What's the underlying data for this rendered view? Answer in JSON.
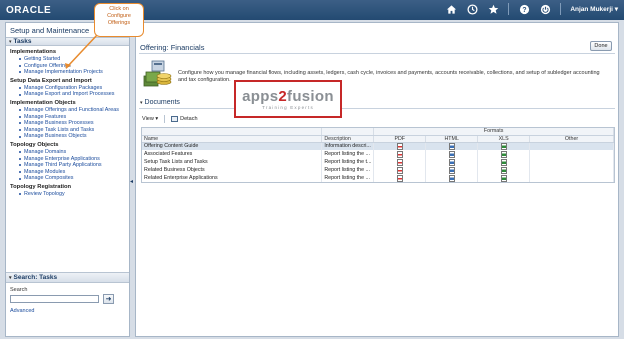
{
  "header": {
    "logo": "ORACLE",
    "user": "Anjan Mukerji ▾",
    "icons": [
      "home-icon",
      "clock-icon",
      "star-icon",
      "help-icon",
      "power-icon"
    ]
  },
  "left_panel": {
    "title": "Setup and Maintenance",
    "tasks_header": "Tasks",
    "groups": [
      {
        "title": "Implementations",
        "items": [
          "Getting Started",
          "Configure Offerings",
          "Manage Implementation Projects"
        ]
      },
      {
        "title": "Setup Data Export and Import",
        "items": [
          "Manage Configuration Packages",
          "Manage Export and Import Processes"
        ]
      },
      {
        "title": "Implementation Objects",
        "items": [
          "Manage Offerings and Functional Areas",
          "Manage Features",
          "Manage Business Processes",
          "Manage Task Lists and Tasks",
          "Manage Business Objects"
        ]
      },
      {
        "title": "Topology Objects",
        "items": [
          "Manage Domains",
          "Manage Enterprise Applications",
          "Manage Third Party Applications",
          "Manage Modules",
          "Manage Composites"
        ]
      },
      {
        "title": "Topology Registration",
        "items": [
          "Review Topology"
        ]
      }
    ],
    "search": {
      "header": "Search: Tasks",
      "label": "Search",
      "value": "",
      "advanced": "Advanced"
    }
  },
  "callout": {
    "lines": [
      "Click on",
      "Configure",
      "Offerings"
    ]
  },
  "main": {
    "title": "Offering: Financials",
    "done_button": "Done",
    "description": "Configure how you manage financial flows, including assets, ledgers, cash cycle, invoices and payments, accounts receivable, collections, and setup of subledger accounting and tax configuration.",
    "documents_header": "Documents",
    "toolbar": {
      "view": "View ▾",
      "detach": "Detach"
    },
    "table": {
      "columns": {
        "name": "Name",
        "description": "Description",
        "formats": "Formats",
        "pdf": "PDF",
        "html": "HTML",
        "xls": "XLS",
        "other": "Other"
      },
      "rows": [
        {
          "name": "Offering Content Guide",
          "description": "Information descri...",
          "pdf": true,
          "html": true,
          "xls": true,
          "selected": true
        },
        {
          "name": "Associated Features",
          "description": "Report listing the ...",
          "pdf": true,
          "html": true,
          "xls": true,
          "selected": false
        },
        {
          "name": "Setup Task Lists and Tasks",
          "description": "Report listing the t...",
          "pdf": true,
          "html": true,
          "xls": true,
          "selected": false
        },
        {
          "name": "Related Business Objects",
          "description": "Report listing the ...",
          "pdf": true,
          "html": true,
          "xls": true,
          "selected": false
        },
        {
          "name": "Related Enterprise Applications",
          "description": "Report listing the ...",
          "pdf": true,
          "html": true,
          "xls": true,
          "selected": false
        }
      ]
    }
  },
  "watermark": {
    "prefix": "apps",
    "number": "2",
    "suffix": "fusion",
    "tagline": "Training Experts"
  },
  "colors": {
    "header_bg": "#2b5078",
    "link": "#1a4b9c",
    "callout": "#e88b2e",
    "watermark_border": "#c62828",
    "selected_row": "#d9e3ee"
  }
}
